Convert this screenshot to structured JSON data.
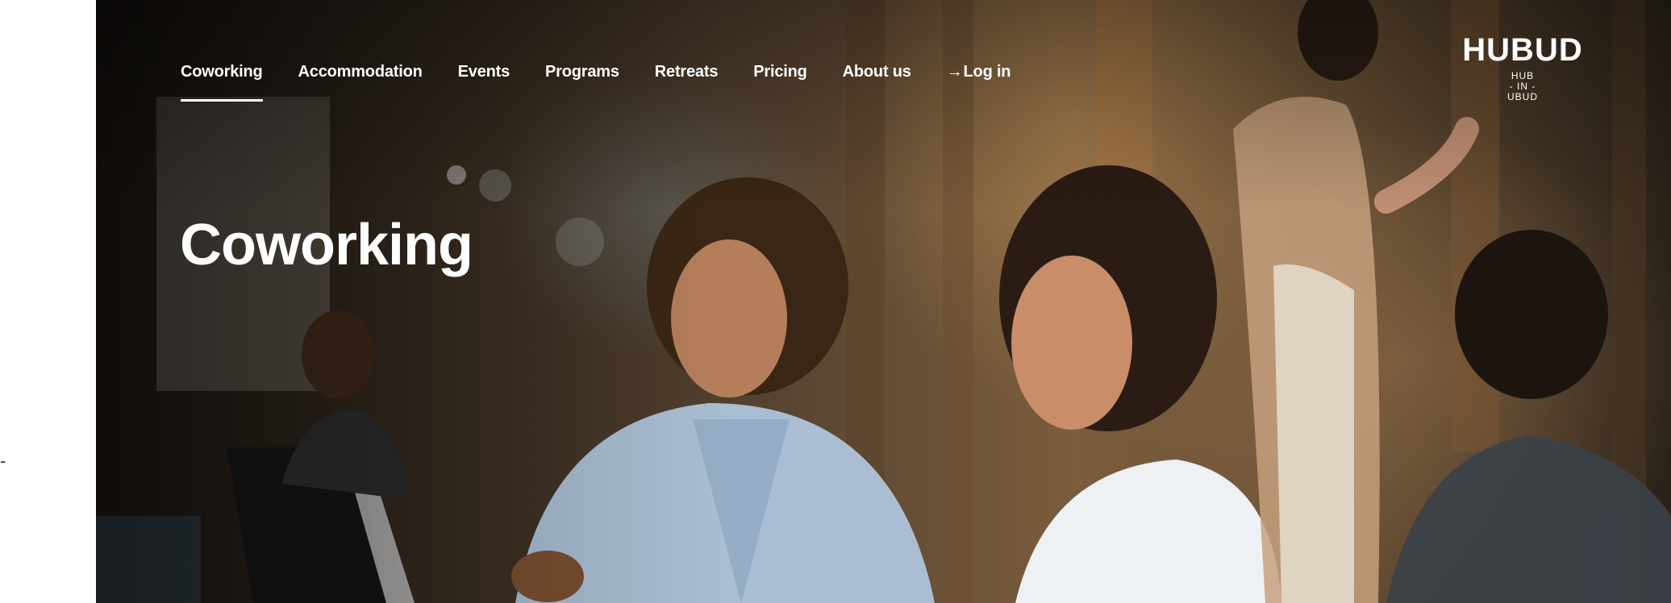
{
  "side_marker": "-",
  "nav": {
    "items": [
      {
        "label": "Coworking",
        "active": true
      },
      {
        "label": "Accommodation"
      },
      {
        "label": "Events"
      },
      {
        "label": "Programs"
      },
      {
        "label": "Retreats"
      },
      {
        "label": "Pricing"
      },
      {
        "label": "About us"
      }
    ],
    "login": {
      "arrow": "→",
      "label": "Log in"
    }
  },
  "hero": {
    "title": "Coworking",
    "image_description": "coworking-space-photo"
  },
  "logo": {
    "word": "HUBUD",
    "tagline": [
      "HUB",
      "- IN -",
      "UBUD"
    ]
  }
}
